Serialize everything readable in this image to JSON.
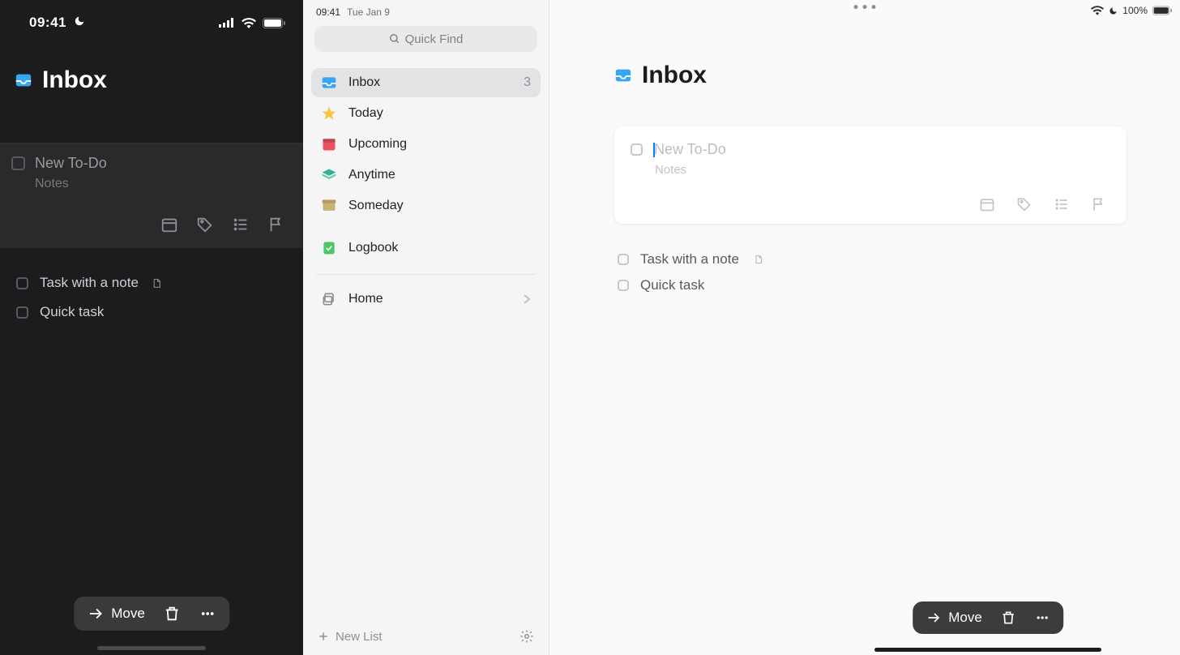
{
  "iphone": {
    "status_time": "09:41",
    "title": "Inbox",
    "new_todo_placeholder": "New To-Do",
    "notes_placeholder": "Notes",
    "tasks": [
      {
        "label": "Task with a note",
        "has_note": true
      },
      {
        "label": "Quick task",
        "has_note": false
      }
    ],
    "move_label": "Move"
  },
  "ipad": {
    "status_time": "09:41",
    "status_date": "Tue Jan 9",
    "battery_pct": "100%",
    "search_placeholder": "Quick Find",
    "sidebar": {
      "items": [
        {
          "label": "Inbox",
          "count": "3",
          "color": "#36a7f0",
          "selected": true
        },
        {
          "label": "Today",
          "color": "#f7c744"
        },
        {
          "label": "Upcoming",
          "color": "#ea5262"
        },
        {
          "label": "Anytime",
          "color": "#2fb298"
        },
        {
          "label": "Someday",
          "color": "#c9b27a"
        }
      ],
      "logbook_label": "Logbook",
      "areas": [
        {
          "label": "Home"
        }
      ],
      "new_list_label": "New List"
    },
    "main": {
      "title": "Inbox",
      "new_todo_placeholder": "New To-Do",
      "notes_placeholder": "Notes",
      "tasks": [
        {
          "label": "Task with a note",
          "has_note": true
        },
        {
          "label": "Quick task",
          "has_note": false
        }
      ],
      "move_label": "Move"
    }
  }
}
